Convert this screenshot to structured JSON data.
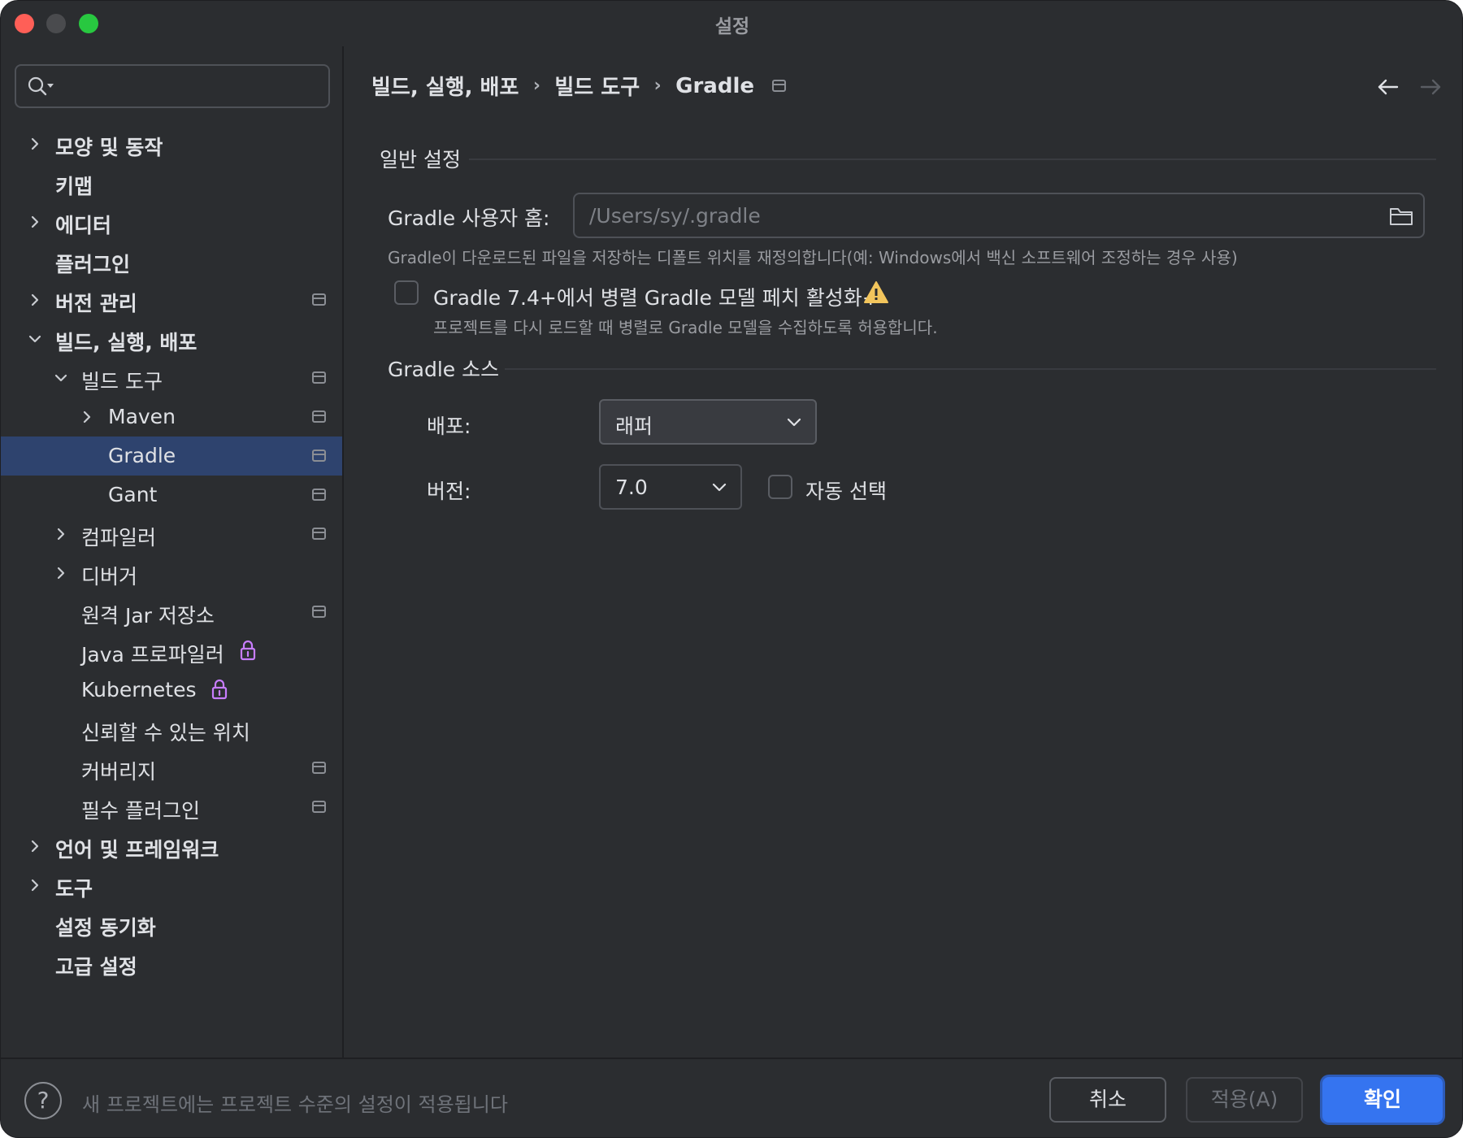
{
  "window": {
    "title": "설정"
  },
  "search": {
    "placeholder": ""
  },
  "sidebar": {
    "items": [
      {
        "label": "모양 및 동작",
        "bold": true,
        "chevron": "right",
        "project_icon": false
      },
      {
        "label": "키맵",
        "bold": true,
        "chevron": "",
        "project_icon": false
      },
      {
        "label": "에디터",
        "bold": true,
        "chevron": "right",
        "project_icon": false
      },
      {
        "label": "플러그인",
        "bold": true,
        "chevron": "",
        "project_icon": false
      },
      {
        "label": "버전 관리",
        "bold": true,
        "chevron": "right",
        "project_icon": true
      },
      {
        "label": "빌드, 실행, 배포",
        "bold": true,
        "chevron": "down",
        "project_icon": false
      },
      {
        "label": "빌드 도구",
        "bold": false,
        "chevron": "down",
        "project_icon": true
      },
      {
        "label": "Maven",
        "bold": false,
        "chevron": "right",
        "project_icon": true
      },
      {
        "label": "Gradle",
        "bold": false,
        "chevron": "",
        "project_icon": true,
        "selected": true
      },
      {
        "label": "Gant",
        "bold": false,
        "chevron": "",
        "project_icon": true
      },
      {
        "label": "컴파일러",
        "bold": false,
        "chevron": "right",
        "project_icon": true
      },
      {
        "label": "디버거",
        "bold": false,
        "chevron": "right",
        "project_icon": false
      },
      {
        "label": "원격 Jar 저장소",
        "bold": false,
        "chevron": "",
        "project_icon": true
      },
      {
        "label": "Java 프로파일러",
        "bold": false,
        "chevron": "",
        "project_icon": false,
        "lock": true
      },
      {
        "label": "Kubernetes",
        "bold": false,
        "chevron": "",
        "project_icon": false,
        "lock": true
      },
      {
        "label": "신뢰할 수 있는 위치",
        "bold": false,
        "chevron": "",
        "project_icon": false
      },
      {
        "label": "커버리지",
        "bold": false,
        "chevron": "",
        "project_icon": true
      },
      {
        "label": "필수 플러그인",
        "bold": false,
        "chevron": "",
        "project_icon": true
      },
      {
        "label": "언어 및 프레임워크",
        "bold": true,
        "chevron": "right",
        "project_icon": false
      },
      {
        "label": "도구",
        "bold": true,
        "chevron": "right",
        "project_icon": false
      },
      {
        "label": "설정 동기화",
        "bold": true,
        "chevron": "",
        "project_icon": false
      },
      {
        "label": "고급 설정",
        "bold": true,
        "chevron": "",
        "project_icon": false
      }
    ],
    "icons": {
      "chevron_right": "chevron-right-icon",
      "chevron_down": "chevron-down-icon",
      "lock": "lock-icon",
      "project": "project-level-icon"
    },
    "lock_color": "#c77dff",
    "selected_color": "#2e436e"
  },
  "breadcrumb": {
    "items": [
      "빌드, 실행, 배포",
      "빌드 도구",
      "Gradle"
    ],
    "separator": "›"
  },
  "general": {
    "section_title": "일반 설정",
    "user_home_label": "Gradle 사용자 홈:",
    "user_home_value": "/Users/sy/.gradle",
    "user_home_hint": "Gradle이 다운로드된 파일을 저장하는 디폴트 위치를 재정의합니다(예: Windows에서 백신 소프트웨어 조정하는 경우 사용)",
    "parallel_label": "Gradle 7.4+에서 병렬 Gradle 모델 페치 활성화+",
    "parallel_checked": false,
    "parallel_hint": "프로젝트를 다시 로드할 때 병렬로 Gradle 모델을 수집하도록 허용합니다.",
    "warning_color": "#f2c55c"
  },
  "source": {
    "section_title": "Gradle 소스",
    "distribution_label": "배포:",
    "distribution_value": "래퍼",
    "version_label": "버전:",
    "version_value": "7.0",
    "auto_select_label": "자동 선택",
    "auto_select_checked": false
  },
  "footer": {
    "help_label": "?",
    "info_text": "새 프로젝트에는 프로젝트 수준의 설정이 적용됩니다",
    "cancel_label": "취소",
    "apply_label": "적용(A)",
    "ok_label": "확인",
    "accent_color": "#3574f0"
  }
}
